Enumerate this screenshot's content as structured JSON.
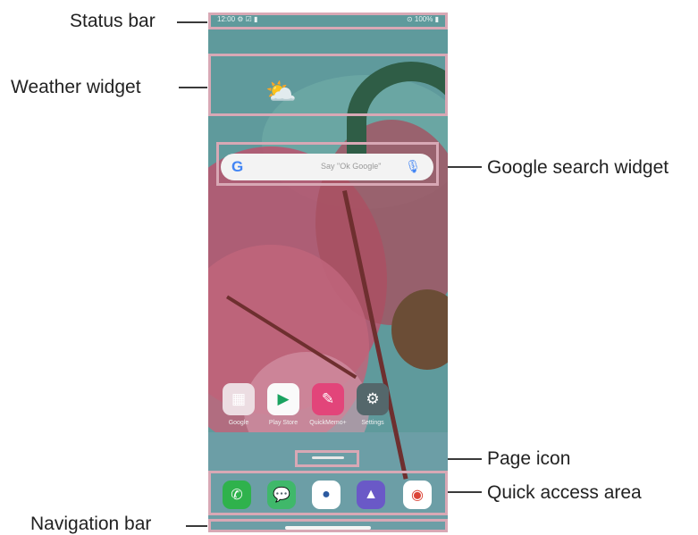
{
  "callouts": {
    "status_bar": "Status bar",
    "weather_widget": "Weather widget",
    "google_search_widget": "Google search widget",
    "page_icon": "Page icon",
    "quick_access_area": "Quick access area",
    "navigation_bar": "Navigation bar"
  },
  "screen": {
    "status_left": "12:00 ⚙ ☑ ▮",
    "status_right": "⊙ 100% ▮",
    "search_hint": "Say \"Ok Google\"",
    "apps": [
      "Google",
      "Play Store",
      "QuickMemo+",
      "Settings"
    ],
    "dock": [
      "phone-icon",
      "messages-icon",
      "camera-icon",
      "gallery-icon",
      "chrome-icon"
    ]
  },
  "colors": {
    "highlight": "#d8a8b5",
    "wallpaper_teal": "#5f9a9c",
    "wallpaper_pink": "#b8556f"
  }
}
